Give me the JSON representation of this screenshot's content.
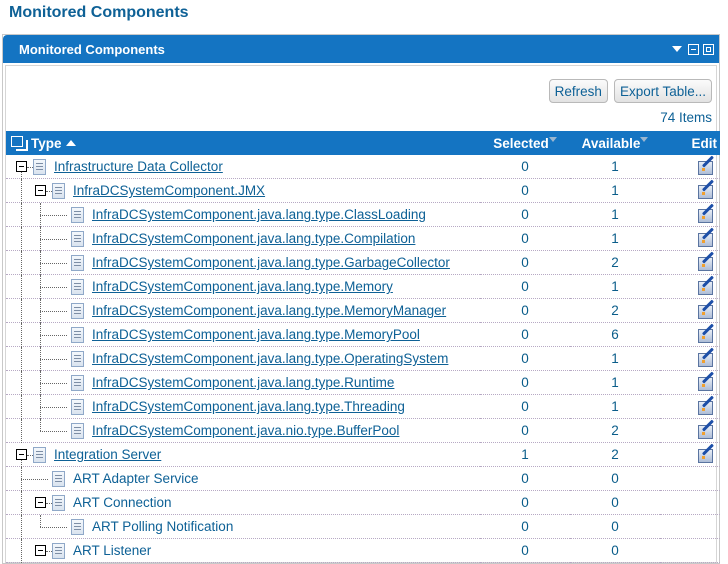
{
  "page_title": "Monitored Components",
  "portlet": {
    "title": "Monitored Components",
    "controls": [
      "menu-dropdown",
      "minimize",
      "maximize"
    ]
  },
  "toolbar": {
    "refresh_label": "Refresh",
    "export_label": "Export Table..."
  },
  "item_count": "74 Items",
  "table": {
    "columns": {
      "type": "Type",
      "selected": "Selected",
      "available": "Available",
      "edit": "Edit"
    },
    "rows": [
      {
        "level": 0,
        "name": "Infrastructure Data Collector",
        "link": true,
        "expandable": true,
        "selected": "0",
        "available": "1",
        "edit": true
      },
      {
        "level": 1,
        "name": "InfraDCSystemComponent.JMX",
        "link": true,
        "expandable": true,
        "selected": "0",
        "available": "1",
        "edit": true
      },
      {
        "level": 2,
        "name": "InfraDCSystemComponent.java.lang.type.ClassLoading",
        "link": true,
        "expandable": false,
        "selected": "0",
        "available": "1",
        "edit": true
      },
      {
        "level": 2,
        "name": "InfraDCSystemComponent.java.lang.type.Compilation",
        "link": true,
        "expandable": false,
        "selected": "0",
        "available": "1",
        "edit": true
      },
      {
        "level": 2,
        "name": "InfraDCSystemComponent.java.lang.type.GarbageCollector",
        "link": true,
        "expandable": false,
        "selected": "0",
        "available": "2",
        "edit": true
      },
      {
        "level": 2,
        "name": "InfraDCSystemComponent.java.lang.type.Memory",
        "link": true,
        "expandable": false,
        "selected": "0",
        "available": "1",
        "edit": true
      },
      {
        "level": 2,
        "name": "InfraDCSystemComponent.java.lang.type.MemoryManager",
        "link": true,
        "expandable": false,
        "selected": "0",
        "available": "2",
        "edit": true
      },
      {
        "level": 2,
        "name": "InfraDCSystemComponent.java.lang.type.MemoryPool",
        "link": true,
        "expandable": false,
        "selected": "0",
        "available": "6",
        "edit": true
      },
      {
        "level": 2,
        "name": "InfraDCSystemComponent.java.lang.type.OperatingSystem",
        "link": true,
        "expandable": false,
        "selected": "0",
        "available": "1",
        "edit": true
      },
      {
        "level": 2,
        "name": "InfraDCSystemComponent.java.lang.type.Runtime",
        "link": true,
        "expandable": false,
        "selected": "0",
        "available": "1",
        "edit": true
      },
      {
        "level": 2,
        "name": "InfraDCSystemComponent.java.lang.type.Threading",
        "link": true,
        "expandable": false,
        "selected": "0",
        "available": "1",
        "edit": true
      },
      {
        "level": 2,
        "name": "InfraDCSystemComponent.java.nio.type.BufferPool",
        "link": true,
        "expandable": false,
        "selected": "0",
        "available": "2",
        "edit": true,
        "last": true
      },
      {
        "level": 0,
        "name": "Integration Server",
        "link": true,
        "expandable": true,
        "selected": "1",
        "available": "2",
        "edit": true
      },
      {
        "level": 1,
        "name": "ART Adapter Service",
        "link": false,
        "expandable": false,
        "selected": "0",
        "available": "0",
        "edit": false
      },
      {
        "level": 1,
        "name": "ART Connection",
        "link": false,
        "expandable": true,
        "selected": "0",
        "available": "0",
        "edit": false
      },
      {
        "level": 2,
        "name": "ART Polling Notification",
        "link": false,
        "expandable": false,
        "selected": "0",
        "available": "0",
        "edit": false,
        "last": true
      },
      {
        "level": 1,
        "name": "ART Listener",
        "link": false,
        "expandable": true,
        "selected": "0",
        "available": "0",
        "edit": false
      }
    ]
  }
}
